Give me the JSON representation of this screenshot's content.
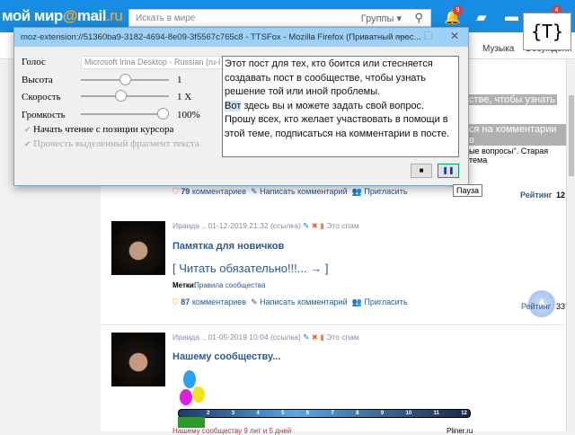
{
  "header": {
    "logo_main": "мой мир",
    "logo_at": "@",
    "logo_mail": "mail",
    "logo_ru": ".ru",
    "search_placeholder": "Искать в мире",
    "search_scope": "Группы",
    "notif_count": "9",
    "msg_count": "4"
  },
  "nav": {
    "music": "Музыка",
    "discussions": "Обсуждени"
  },
  "tts_badge": "{T}",
  "popup": {
    "title": "moz-extension://51360ba9-3182-4694-8e09-3f5567c765c8 - TTSFox - Mozilla Firefox (Приватный прос...",
    "voice_label": "Голос",
    "voice_value": "Microsoft Irina Desktop - Russian (ru-RU)",
    "pitch_label": "Высота",
    "pitch_value": "1",
    "pitch_level": 0.5,
    "rate_label": "Скорость",
    "rate_value": "1 X",
    "rate_level": 0.45,
    "volume_label": "Громкость",
    "volume_value": "100%",
    "volume_level": 1.0,
    "opt_cursor": "Начать чтение с позиции курсора",
    "opt_selected": "Прочесть выделенный фрагмент текста",
    "text_l1": "Этот пост для тех, кто боится или стесняется",
    "text_l2": "создавать пост в сообществе, чтобы узнать",
    "text_l3": "решение той или иной проблемы.",
    "text_word": "Вот",
    "text_l4": " здесь вы и можете задать свой вопрос.",
    "text_l5": "Прошу всех, кто желает участвовать в помощи в",
    "text_l6": "этой теме, подписаться на комментарии в посте.",
    "stop_symbol": "■",
    "pause_symbol": "❚❚",
    "tooltip": "Пауза"
  },
  "page": {
    "hl1": "стве, чтобы узнать",
    "hl2": "ся на комментарии в",
    "frag": "ые вопросы\". Старая тема",
    "post0": {
      "comments_count": "79",
      "comments": "комментариев",
      "write": "Написать комментарий",
      "invite": "Пригласить",
      "rating": "Рейтинг",
      "rating_val": "12"
    },
    "post1": {
      "author": "Ираида .",
      "date": "01-12-2019 21:32",
      "link": "(ссылка)",
      "spam": "Это спам",
      "title": "Памятка для новичков",
      "read": "[ Читать обязательно!!!... → ]",
      "tags_label": "Метки:",
      "tag": "Правила сообщества",
      "comments_count": "87",
      "comments": "комментариев",
      "write": "Написать комментарий",
      "invite": "Пригласить",
      "rating": "Рейтинг",
      "rating_val": "33"
    },
    "post2": {
      "author": "Ираида .",
      "date": "01-05-2019 10:04",
      "link": "(ссылка)",
      "spam": "Это спам",
      "title": "Нашему сообществу...",
      "timeline": [
        "2",
        "3",
        "4",
        "5",
        "6",
        "7",
        "8",
        "9",
        "10",
        "11",
        "12"
      ],
      "caption": "Нашему сообществу 9 лет и 5 дней",
      "site": "Pliner.ru"
    }
  }
}
